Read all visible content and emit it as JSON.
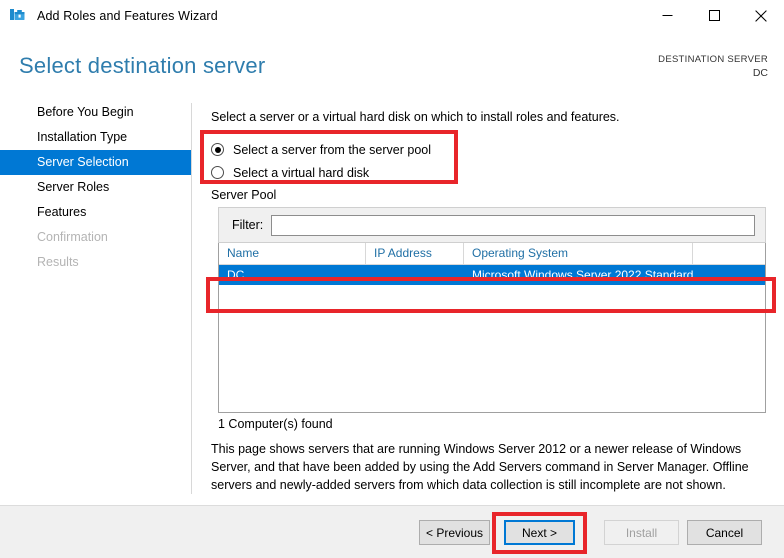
{
  "window": {
    "title": "Add Roles and Features Wizard",
    "icon": "server-manager-icon",
    "controls": {
      "minimize": "minimize-icon",
      "maximize": "maximize-icon",
      "close": "close-icon"
    }
  },
  "header": {
    "page_title": "Select destination server",
    "destination_label": "DESTINATION SERVER",
    "destination_value": "DC"
  },
  "sidebar": {
    "items": [
      {
        "label": "Before You Begin",
        "state": "normal"
      },
      {
        "label": "Installation Type",
        "state": "normal"
      },
      {
        "label": "Server Selection",
        "state": "selected"
      },
      {
        "label": "Server Roles",
        "state": "normal"
      },
      {
        "label": "Features",
        "state": "normal"
      },
      {
        "label": "Confirmation",
        "state": "disabled"
      },
      {
        "label": "Results",
        "state": "disabled"
      }
    ]
  },
  "main": {
    "intro": "Select a server or a virtual hard disk on which to install roles and features.",
    "radios": [
      {
        "label": "Select a server from the server pool",
        "checked": true
      },
      {
        "label": "Select a virtual hard disk",
        "checked": false
      }
    ],
    "server_pool": {
      "group_label": "Server Pool",
      "filter_label": "Filter:",
      "filter_value": "",
      "filter_placeholder": "",
      "columns": [
        "Name",
        "IP Address",
        "Operating System",
        ""
      ],
      "rows": [
        {
          "name": "DC",
          "ip_address": "",
          "operating_system": "Microsoft Windows Server 2022 Standard",
          "pad": "",
          "selected": true
        }
      ],
      "count_text": "1 Computer(s) found"
    },
    "footnote": "This page shows servers that are running Windows Server 2012 or a newer release of Windows Server, and that have been added by using the Add Servers command in Server Manager. Offline servers and newly-added servers from which data collection is still incomplete are not shown."
  },
  "footer": {
    "previous": "< Previous",
    "next": "Next >",
    "install": "Install",
    "cancel": "Cancel"
  },
  "colors": {
    "accent_blue": "#0078d4",
    "title_blue": "#2f7dad",
    "header_text_blue": "#1f6fa5",
    "annotation_red": "#e8252a",
    "disabled_gray": "#b4b4b4"
  },
  "annotations": [
    {
      "name": "radio-group-highlight",
      "color": "#e8252a"
    },
    {
      "name": "selected-server-row-highlight",
      "color": "#e8252a"
    },
    {
      "name": "next-button-highlight",
      "color": "#e8252a"
    }
  ]
}
